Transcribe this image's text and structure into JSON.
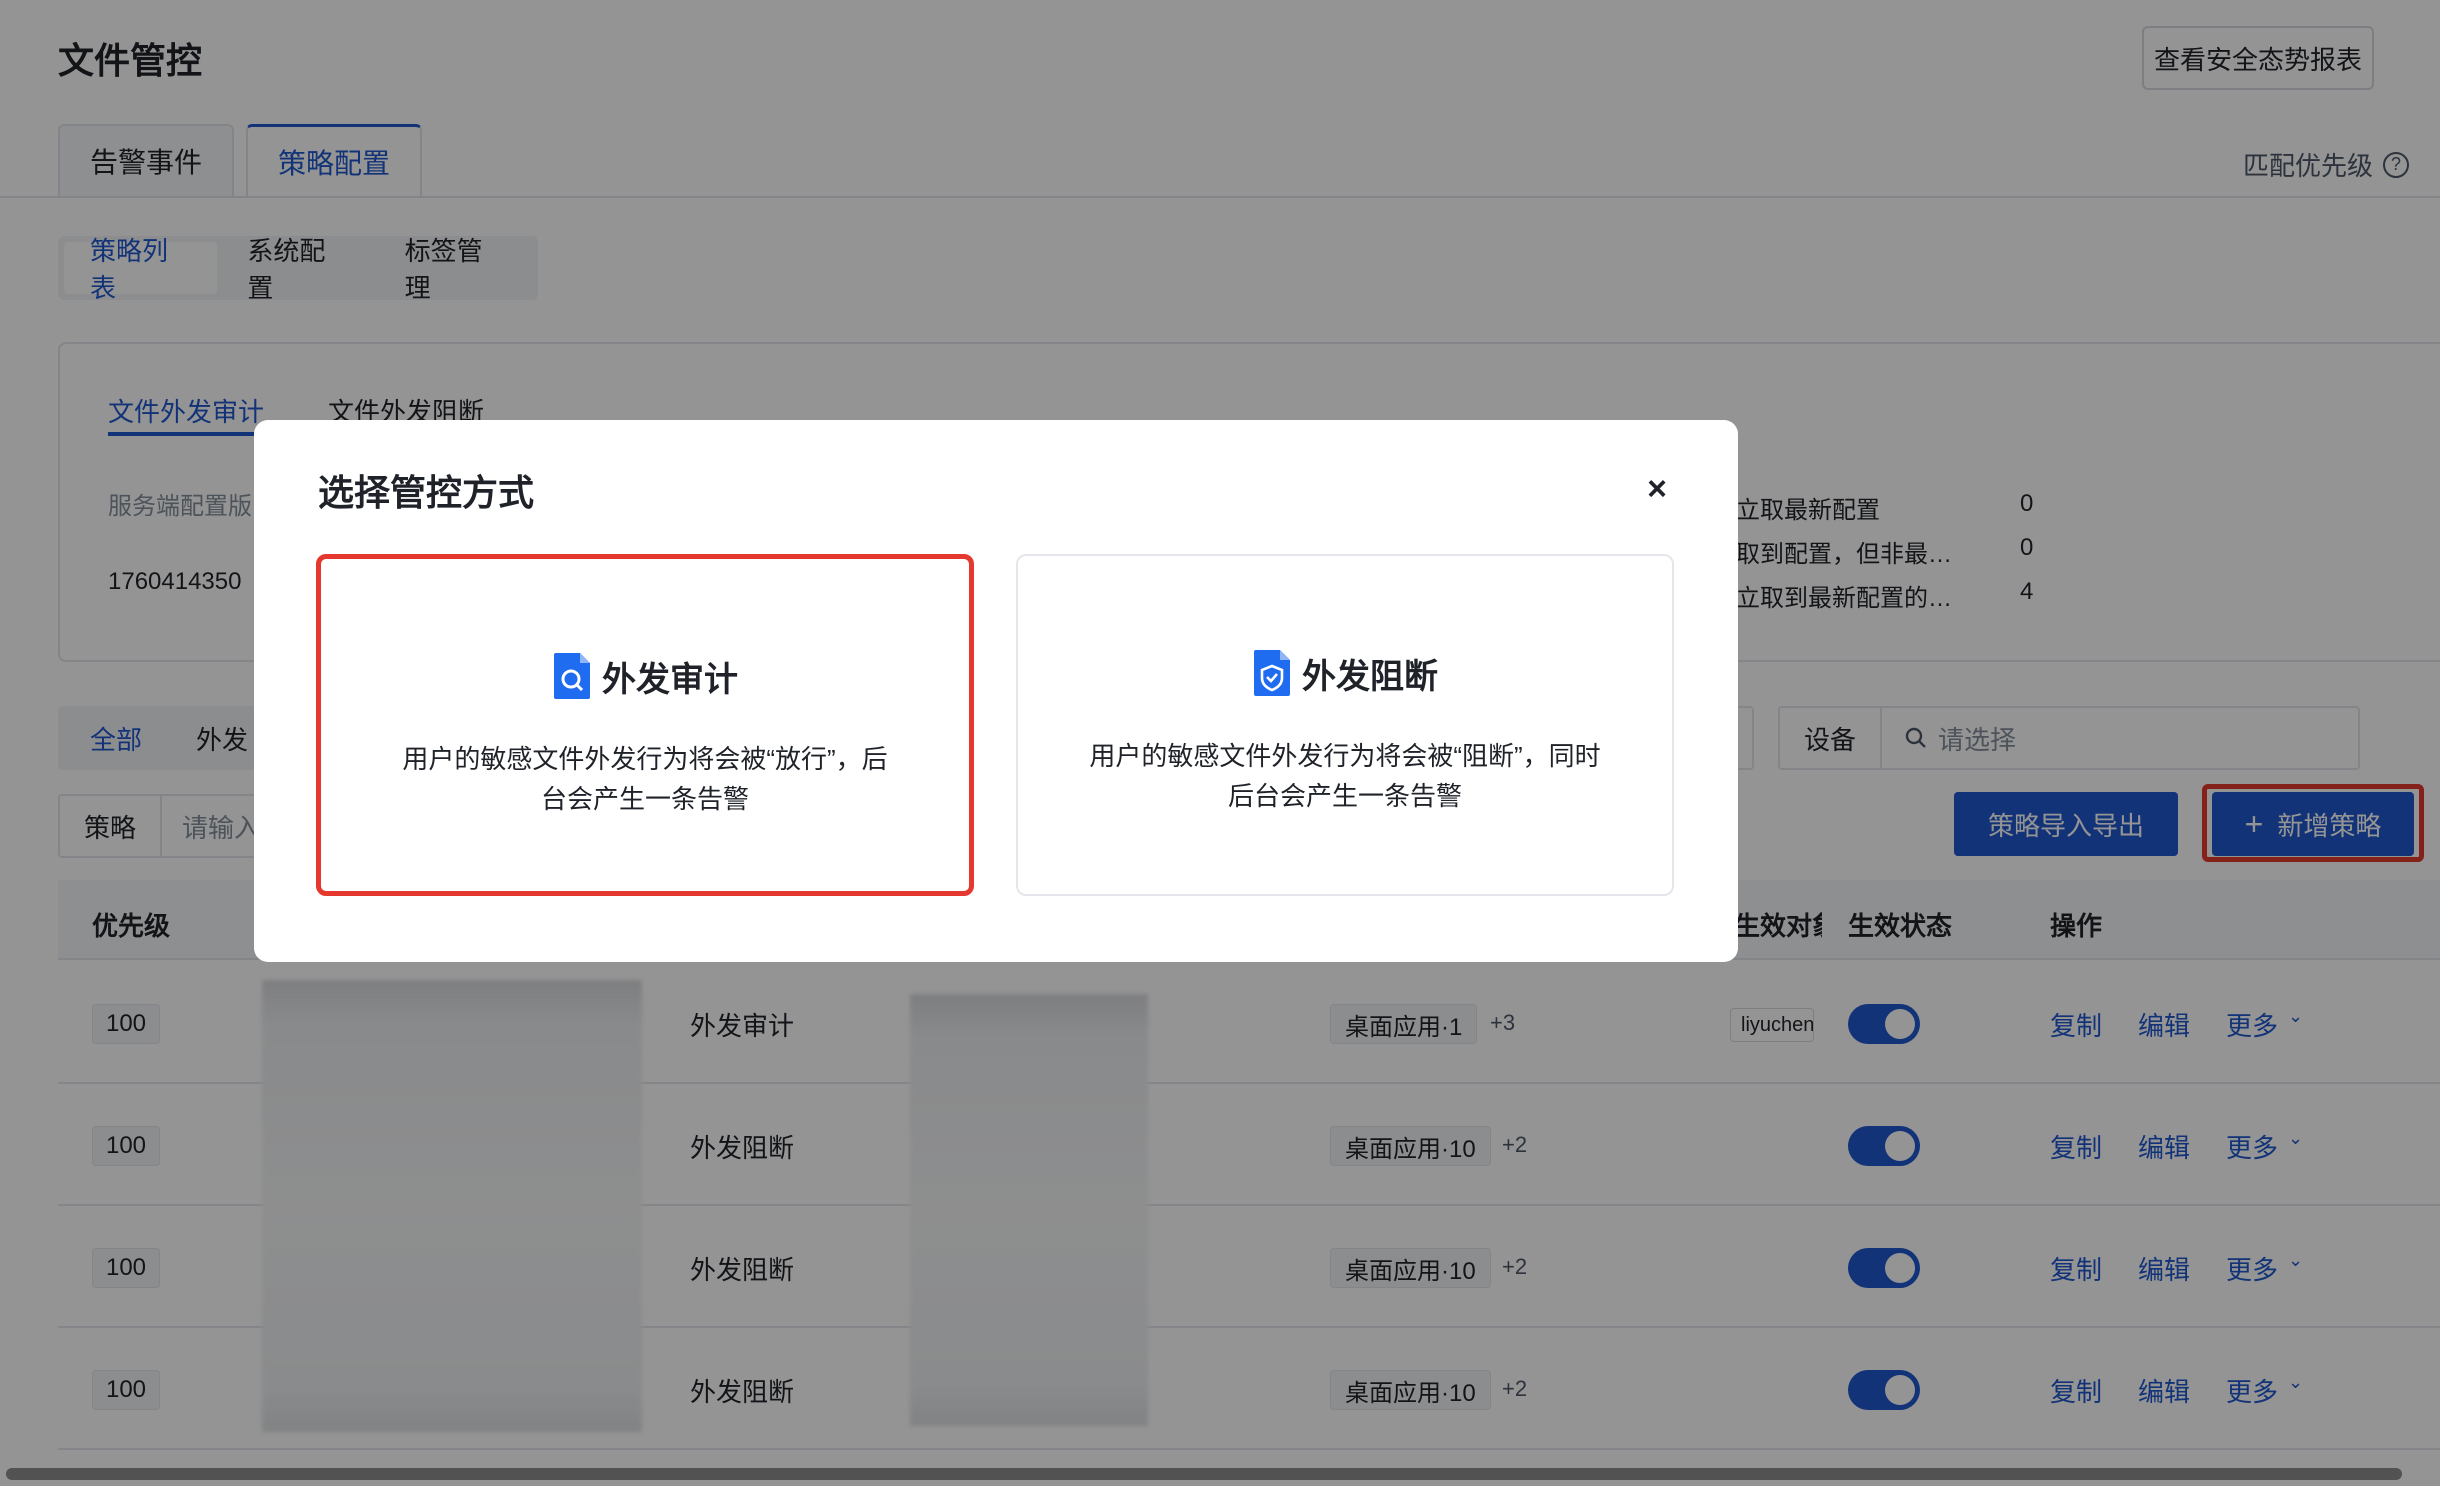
{
  "page": {
    "title": "文件管控",
    "report_button": "查看安全态势报表",
    "tabs": [
      {
        "label": "告警事件",
        "active": false
      },
      {
        "label": "策略配置",
        "active": true
      }
    ],
    "match_priority": "匹配优先级",
    "help_icon": "question-circle-icon"
  },
  "subnav": {
    "items": [
      {
        "label": "策略列表",
        "active": true
      },
      {
        "label": "系统配置",
        "active": false
      },
      {
        "label": "标签管理",
        "active": false
      }
    ]
  },
  "card": {
    "tabs": [
      {
        "label": "文件外发审计",
        "active": true
      },
      {
        "label": "文件外发阻断",
        "active": false
      }
    ],
    "server_config_label": "服务端配置版",
    "server_config_value": "1760414350",
    "stats": [
      {
        "label": "立取最新配置",
        "value": "0"
      },
      {
        "label": "取到配置，但非最…",
        "value": "0"
      },
      {
        "label": "立取到最新配置的…",
        "value": "4"
      }
    ]
  },
  "filters": {
    "scope_all": "全部",
    "scope_out": "外发",
    "device_label": "设备",
    "device_placeholder": "请选择",
    "policy_label": "策略",
    "policy_placeholder": "请输入"
  },
  "actions": {
    "import_export": "策略导入导出",
    "add_policy": "新增策略"
  },
  "table": {
    "headers": {
      "priority": "优先级",
      "effective_target": "生效对象",
      "status": "生效状态",
      "operation": "操作"
    },
    "rows": [
      {
        "priority": "100",
        "type": "外发审计",
        "app": "桌面应用·1",
        "extra": "+3",
        "user": "liyuchen",
        "enabled": true
      },
      {
        "priority": "100",
        "type": "外发阻断",
        "app": "桌面应用·10",
        "extra": "+2",
        "user": "",
        "enabled": true
      },
      {
        "priority": "100",
        "type": "外发阻断",
        "app": "桌面应用·10",
        "extra": "+2",
        "user": "",
        "enabled": true
      },
      {
        "priority": "100",
        "type": "外发阻断",
        "app": "桌面应用·10",
        "extra": "+2",
        "user": "",
        "enabled": true
      }
    ],
    "ops": {
      "copy": "复制",
      "edit": "编辑",
      "more": "更多"
    }
  },
  "modal": {
    "title": "选择管控方式",
    "close_icon": "close-icon",
    "options": [
      {
        "title": "外发审计",
        "icon": "document-search-icon",
        "description": "用户的敏感文件外发行为将会被“放行”，后台会产生一条告警",
        "selected": true
      },
      {
        "title": "外发阻断",
        "icon": "document-shield-icon",
        "description": "用户的敏感文件外发行为将会被“阻断”，同时后台会产生一条告警",
        "selected": false
      }
    ]
  },
  "colors": {
    "primary": "#1f58cf",
    "highlight": "#e5392f"
  }
}
